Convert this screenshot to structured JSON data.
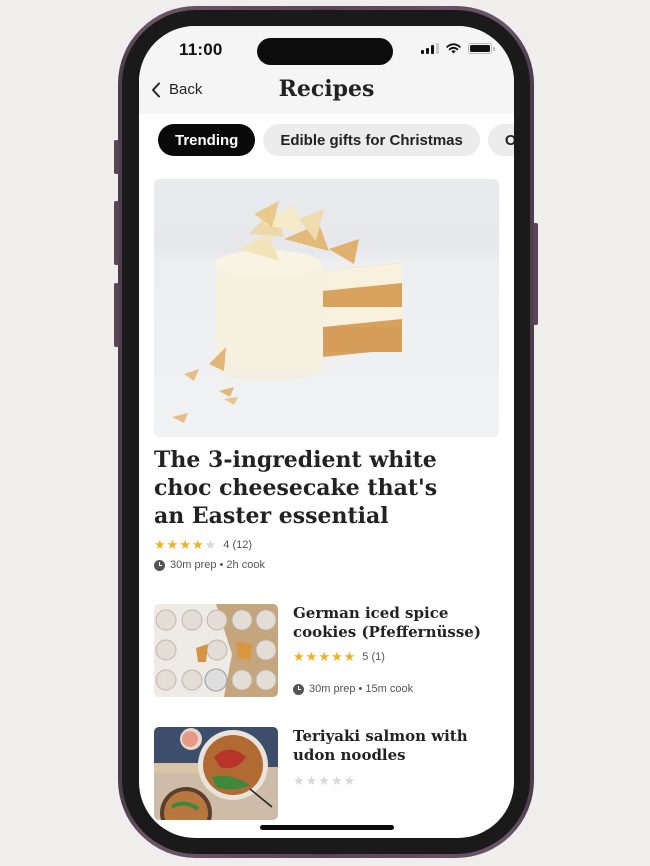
{
  "status_bar": {
    "time": "11:00",
    "signal_icon": "cellular-signal-icon",
    "wifi_icon": "wifi-icon",
    "battery_icon": "battery-icon"
  },
  "header": {
    "back_label": "Back",
    "back_icon": "chevron-left-icon",
    "title": "Recipes"
  },
  "chips": [
    {
      "label": "Trending",
      "active": true
    },
    {
      "label": "Edible gifts for Christmas",
      "active": false
    },
    {
      "label": "Our u",
      "active": false
    }
  ],
  "featured": {
    "title": "The 3-ingredient white choc cheesecake that's an Easter essential",
    "image": "white-chocolate-layer-cake-photo",
    "rating": {
      "value": 4,
      "max": 5,
      "label": "4 (12)"
    },
    "time": "30m prep • 2h cook"
  },
  "recipes": [
    {
      "title": "German iced spice cookies (Pfeffernüsse)",
      "image": "iced-spice-cookies-photo",
      "rating": {
        "value": 5,
        "max": 5,
        "label": "5 (1)"
      },
      "time": "30m prep • 15m cook"
    },
    {
      "title": "Teriyaki salmon with udon noodles",
      "image": "teriyaki-salmon-noodles-photo",
      "rating": {
        "value": 0,
        "max": 5,
        "label": ""
      },
      "time": ""
    }
  ],
  "colors": {
    "star_on": "#f2b01e",
    "star_off": "#d8d8d8",
    "chip_active_bg": "#0a0a0a",
    "chip_bg": "#ececec",
    "frame": "#5a4556"
  }
}
